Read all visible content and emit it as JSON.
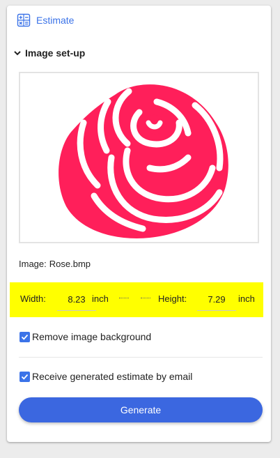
{
  "header": {
    "title": "Estimate",
    "icon": "calculator-icon"
  },
  "section": {
    "title": "Image set-up",
    "expanded": true
  },
  "image": {
    "label_prefix": "Image:",
    "filename": "Rose.bmp",
    "rose_color": "#ff1f5a"
  },
  "dimensions": {
    "width_label": "Width:",
    "width_value": "8.23",
    "width_unit": "inch",
    "height_label": "Height:",
    "height_value": "7.29",
    "height_unit": "inch"
  },
  "options": {
    "remove_background_label": "Remove image background",
    "remove_background_checked": true,
    "email_label": "Receive generated estimate by email",
    "email_checked": true
  },
  "actions": {
    "generate_label": "Generate"
  },
  "colors": {
    "accent": "#3b73e8",
    "button": "#3b67e0",
    "highlight": "#ffff00"
  }
}
